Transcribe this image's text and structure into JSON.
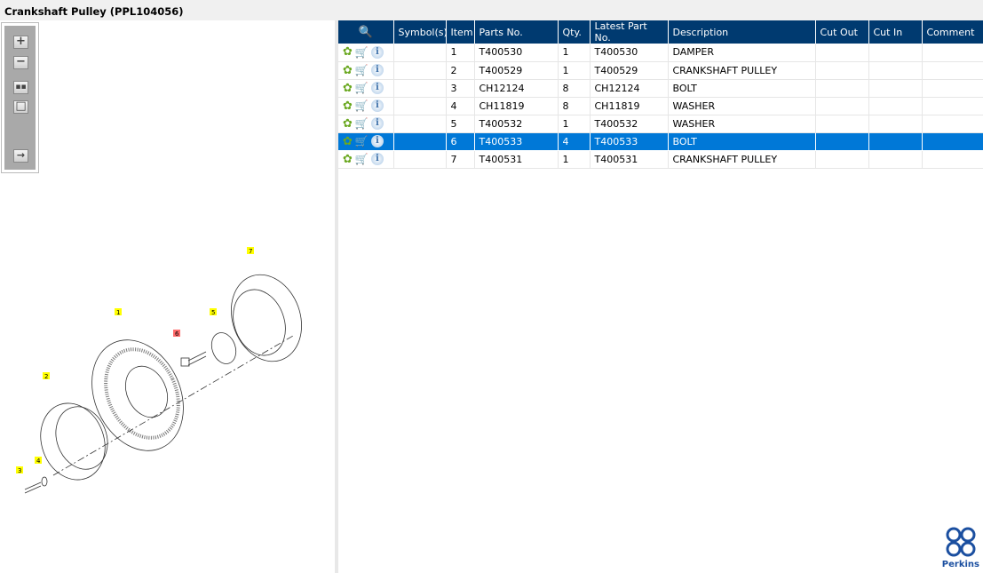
{
  "title": "Crankshaft Pulley (PPL104056)",
  "toolbar": {
    "zoom_in": "+",
    "zoom_out": "−"
  },
  "table": {
    "headers": [
      "",
      "Symbol(s)",
      "Item",
      "Parts No.",
      "Qty.",
      "Latest Part No.",
      "Description",
      "Cut Out",
      "Cut In",
      "Comment"
    ],
    "rows": [
      {
        "item": "1",
        "part": "T400530",
        "qty": "1",
        "latest": "T400530",
        "desc": "DAMPER"
      },
      {
        "item": "2",
        "part": "T400529",
        "qty": "1",
        "latest": "T400529",
        "desc": "CRANKSHAFT PULLEY"
      },
      {
        "item": "3",
        "part": "CH12124",
        "qty": "8",
        "latest": "CH12124",
        "desc": "BOLT"
      },
      {
        "item": "4",
        "part": "CH11819",
        "qty": "8",
        "latest": "CH11819",
        "desc": "WASHER"
      },
      {
        "item": "5",
        "part": "T400532",
        "qty": "1",
        "latest": "T400532",
        "desc": "WASHER"
      },
      {
        "item": "6",
        "part": "T400533",
        "qty": "4",
        "latest": "T400533",
        "desc": "BOLT"
      },
      {
        "item": "7",
        "part": "T400531",
        "qty": "1",
        "latest": "T400531",
        "desc": "CRANKSHAFT PULLEY"
      }
    ],
    "selected_item": "6"
  },
  "diagram": {
    "callouts": [
      "1",
      "2",
      "3",
      "4",
      "5",
      "6",
      "7"
    ],
    "highlighted": "6"
  },
  "logo": {
    "text": "Perkins"
  },
  "colors": {
    "header": "#003a70",
    "selected": "#0078d7",
    "highlight_callout": "#ff6b6b",
    "callout": "#ffff00"
  }
}
